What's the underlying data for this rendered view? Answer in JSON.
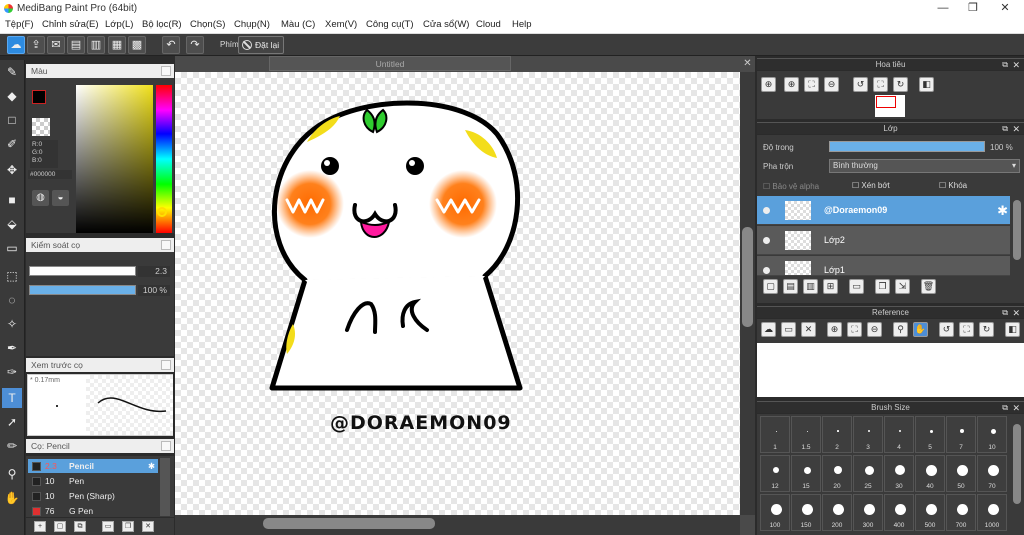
{
  "window": {
    "title": "MediBang Paint Pro (64bit)",
    "minimize": "—",
    "restore": "❐",
    "close": "✕"
  },
  "menu": [
    "Tệp(F)",
    "Chỉnh sửa(E)",
    "Lớp(L)",
    "Bộ lọc(R)",
    "Chọn(S)",
    "Chụp(N)",
    "Màu (C)",
    "Xem(V)",
    "Công cụ(T)",
    "Cửa sổ(W)",
    "Cloud",
    "Help"
  ],
  "toolbar": {
    "phim_label": "Phím",
    "reset_label": "Đặt lại"
  },
  "color_panel": {
    "title": "Màu",
    "rgb": "R:0\nG:0\nB:0",
    "hex": "#000000",
    "fg_color": "#000000",
    "bg_color": "#e00000"
  },
  "brush_control": {
    "title": "Kiểm soát cọ",
    "size_value": "2.3",
    "opacity_value": "100 %",
    "size_fraction": 0.96,
    "opacity_fraction": 1.0
  },
  "brush_preview": {
    "title": "Xem trước cọ",
    "size": "0.17mm"
  },
  "brush_list": {
    "title": "Cọ: Pencil",
    "items": [
      {
        "size": "2.3",
        "name": "Pencil",
        "selected": true,
        "color": "#222222"
      },
      {
        "size": "10",
        "name": "Pen",
        "selected": false,
        "color": "#222222"
      },
      {
        "size": "10",
        "name": "Pen (Sharp)",
        "selected": false,
        "color": "#222222"
      },
      {
        "size": "76",
        "name": "G Pen",
        "selected": false,
        "color": "#e03030"
      }
    ]
  },
  "canvas": {
    "tab_title": "Untitled",
    "signature": "@DORAEMON09"
  },
  "navigator": {
    "title": "Hoa tiêu"
  },
  "layer_panel": {
    "title": "Lớp",
    "opacity_label": "Độ trong",
    "opacity_value": "100 %",
    "blend_label": "Pha trộn",
    "blend_value": "Bình thường",
    "protect_alpha": "Bảo vệ alpha",
    "clipping": "Xén bớt",
    "lock": "Khóa",
    "layers": [
      {
        "name": "@Doraemon09",
        "selected": true
      },
      {
        "name": "Lớp2",
        "selected": false
      },
      {
        "name": "Lớp1",
        "selected": false
      }
    ]
  },
  "reference": {
    "title": "Reference"
  },
  "brush_size": {
    "title": "Brush Size",
    "sizes": [
      "1",
      "1.5",
      "2",
      "3",
      "4",
      "5",
      "7",
      "10",
      "12",
      "15",
      "20",
      "25",
      "30",
      "40",
      "50",
      "70",
      "100",
      "150",
      "200",
      "300",
      "400",
      "500",
      "700",
      "1000"
    ]
  }
}
